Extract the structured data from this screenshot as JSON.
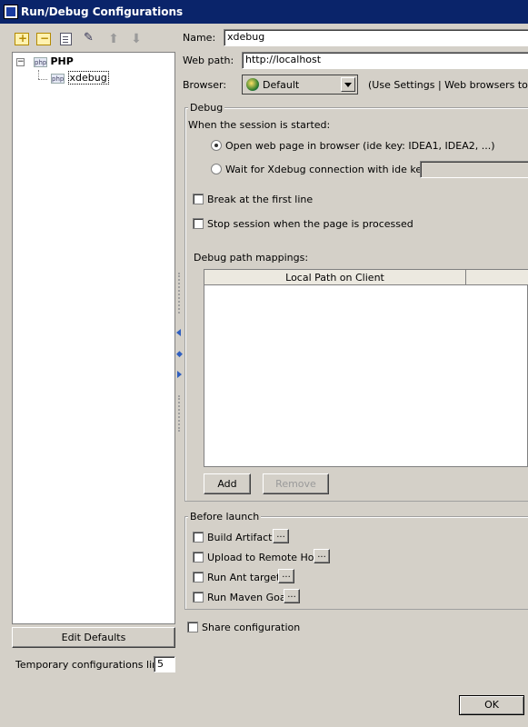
{
  "window": {
    "title": "Run/Debug Configurations"
  },
  "toolbar": {
    "add_icon": "add-icon",
    "remove_icon": "remove-icon",
    "copy_icon": "copy-icon",
    "settings_icon": "settings-icon",
    "up_glyph": "⬆",
    "down_glyph": "⬇"
  },
  "tree": {
    "root_label": "PHP",
    "root_icon_text": "php",
    "child_label": "xdebug",
    "child_icon_text": "php",
    "expander": "−"
  },
  "left": {
    "edit_defaults_label": "Edit Defaults",
    "temp_limit_label": "Temporary configurations limit:",
    "temp_limit_value": "5"
  },
  "form": {
    "name_label": "Name:",
    "name_value": "xdebug",
    "webpath_label": "Web path:",
    "webpath_value": "http://localhost",
    "browser_label": "Browser:",
    "browser_value": "Default",
    "browser_hint": "(Use Settings | Web browsers to con"
  },
  "debug": {
    "title": "Debug",
    "session_label": "When the session is started:",
    "radio_open": "Open web page in browser (ide key: IDEA1, IDEA2, ...)",
    "radio_wait": "Wait for Xdebug connection with ide key:",
    "ide_key_value": "",
    "check_break": "Break at the first line",
    "check_stop": "Stop session when the page is processed",
    "mappings_label": "Debug path mappings:",
    "col_local": "Local Path on Client",
    "col_remote": "",
    "add_label": "Add",
    "remove_label": "Remove"
  },
  "before_launch": {
    "title": "Before launch",
    "items": [
      {
        "label": "Build Artifacts",
        "checked": false
      },
      {
        "label": "Upload to Remote Host",
        "checked": false
      },
      {
        "label": "Run Ant target",
        "checked": false
      },
      {
        "label": "Run Maven Goal",
        "checked": false
      }
    ],
    "more_label": "..."
  },
  "share_label": "Share configuration",
  "ok_label": "OK",
  "colors": {
    "titlebar": "#0a246a",
    "dialog_bg": "#d4d0c8"
  }
}
